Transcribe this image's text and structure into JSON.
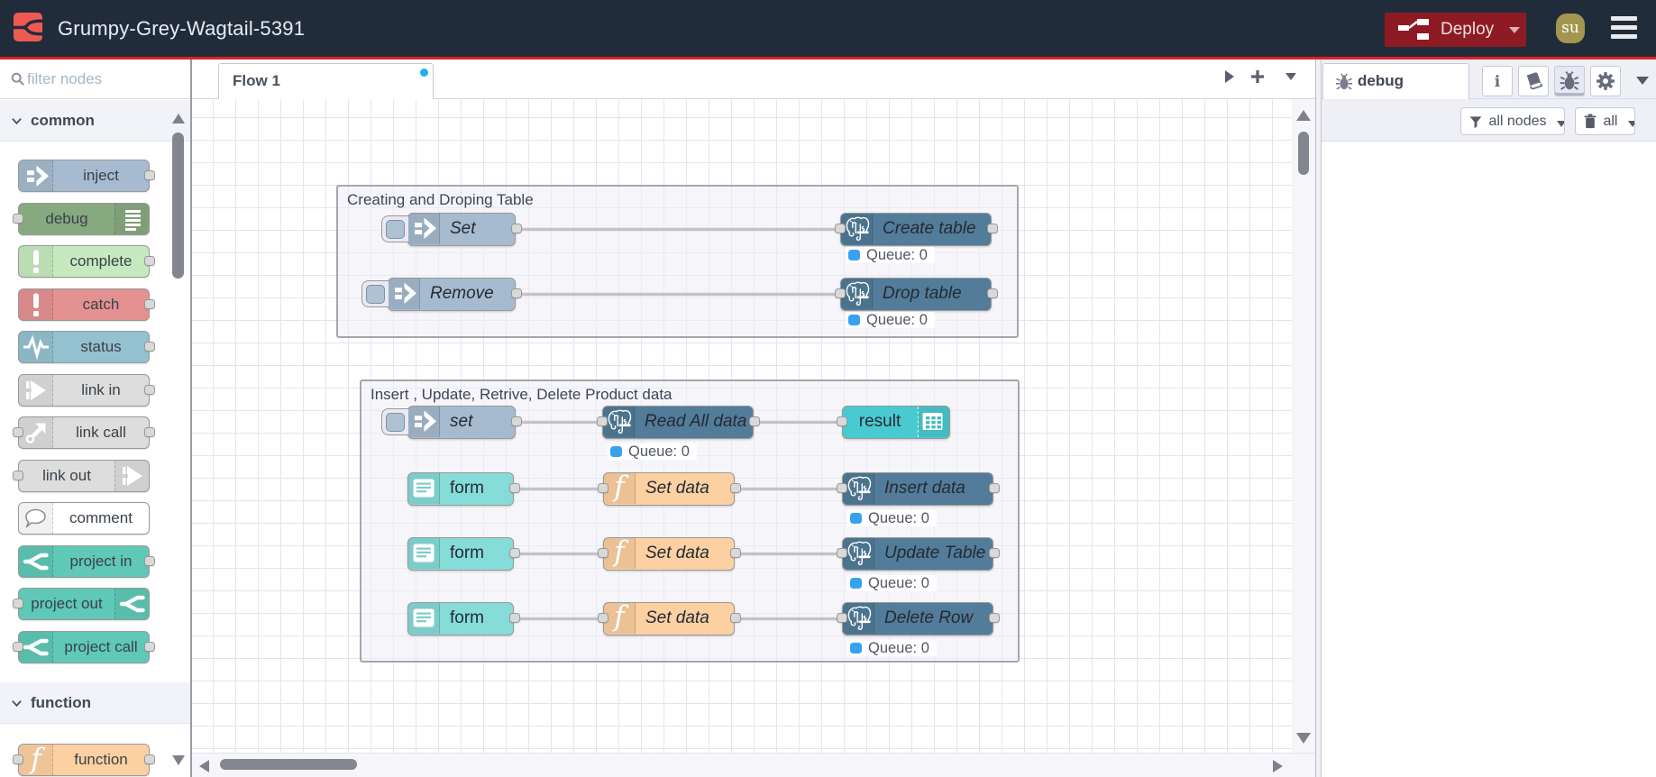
{
  "header": {
    "title": "Grumpy-Grey-Wagtail-5391",
    "deploy_label": "Deploy",
    "avatar_text": "su"
  },
  "palette": {
    "search_placeholder": "filter nodes",
    "sections": [
      {
        "label": "common",
        "items": [
          {
            "id": "inject",
            "label": "inject",
            "color": "#a6bbcf",
            "icon": "inject",
            "iconSide": "left",
            "ports": "right"
          },
          {
            "id": "debug",
            "label": "debug",
            "color": "#87a980",
            "icon": "debuglist",
            "iconSide": "right",
            "ports": "left"
          },
          {
            "id": "complete",
            "label": "complete",
            "color": "#c7e9bf",
            "icon": "exclaim",
            "iconSide": "left",
            "ports": "right"
          },
          {
            "id": "catch",
            "label": "catch",
            "color": "#e49191",
            "icon": "exclaim",
            "iconSide": "left",
            "ports": "right"
          },
          {
            "id": "status",
            "label": "status",
            "color": "#94c1d0",
            "icon": "status",
            "iconSide": "left",
            "ports": "right"
          },
          {
            "id": "link-in",
            "label": "link in",
            "color": "#dddddd",
            "icon": "linkarrow",
            "iconSide": "left",
            "ports": "right"
          },
          {
            "id": "link-call",
            "label": "link call",
            "color": "#dddddd",
            "icon": "linkcall",
            "iconSide": "left",
            "ports": "both"
          },
          {
            "id": "link-out",
            "label": "link out",
            "color": "#dddddd",
            "icon": "linkarrow",
            "iconSide": "right",
            "ports": "left"
          },
          {
            "id": "comment",
            "label": "comment",
            "color": "#ffffff",
            "icon": "comment",
            "iconSide": "left",
            "ports": "none"
          },
          {
            "id": "project-in",
            "label": "project in",
            "color": "#5fc8b6",
            "icon": "fork",
            "iconSide": "left",
            "ports": "right"
          },
          {
            "id": "project-out",
            "label": "project out",
            "color": "#5fc8b6",
            "icon": "fork",
            "iconSide": "right",
            "ports": "left"
          },
          {
            "id": "project-call",
            "label": "project call",
            "color": "#5fc8b6",
            "icon": "fork",
            "iconSide": "left",
            "ports": "both"
          }
        ]
      },
      {
        "label": "function",
        "items": [
          {
            "id": "function",
            "label": "function",
            "color": "#fdd0a2",
            "icon": "functionF",
            "iconSide": "left",
            "ports": "both"
          }
        ]
      }
    ]
  },
  "workspace": {
    "tab_label": "Flow 1"
  },
  "canvas": {
    "groups": [
      {
        "label": "Creating and Droping Table"
      },
      {
        "label": "Insert , Update, Retrive, Delete Product data"
      }
    ],
    "nodes": [
      {
        "id": "set1",
        "label": "Set",
        "type": "inject",
        "status": ""
      },
      {
        "id": "create",
        "label": "Create table",
        "type": "postgres",
        "status": "Queue: 0"
      },
      {
        "id": "remove",
        "label": "Remove",
        "type": "inject",
        "status": ""
      },
      {
        "id": "drop",
        "label": "Drop table",
        "type": "postgres",
        "status": "Queue: 0"
      },
      {
        "id": "set2",
        "label": "set",
        "type": "inject",
        "status": ""
      },
      {
        "id": "readall",
        "label": "Read All data",
        "type": "postgres",
        "status": "Queue: 0"
      },
      {
        "id": "result",
        "label": "result",
        "type": "uitable",
        "status": ""
      },
      {
        "id": "form1",
        "label": "form",
        "type": "form",
        "status": ""
      },
      {
        "id": "setdata1",
        "label": "Set data",
        "type": "function",
        "status": ""
      },
      {
        "id": "insert",
        "label": "Insert data",
        "type": "postgres",
        "status": "Queue: 0"
      },
      {
        "id": "form2",
        "label": "form",
        "type": "form",
        "status": ""
      },
      {
        "id": "setdata2",
        "label": "Set data",
        "type": "function",
        "status": ""
      },
      {
        "id": "update",
        "label": "Update Table",
        "type": "postgres",
        "status": "Queue: 0"
      },
      {
        "id": "form3",
        "label": "form",
        "type": "form",
        "status": ""
      },
      {
        "id": "setdata3",
        "label": "Set data",
        "type": "function",
        "status": ""
      },
      {
        "id": "delete",
        "label": "Delete Row",
        "type": "postgres",
        "status": "Queue: 0"
      }
    ]
  },
  "sidebar": {
    "tab_label": "debug",
    "filter_label": "all nodes",
    "clear_label": "all"
  },
  "colors": {
    "header_bg": "#212c3a",
    "header_line": "#dd2126",
    "logo_bg": "#ee5a52",
    "deploy_bg": "#8e1b24",
    "avatar_bg": "#a3974f",
    "node_inject": "#a6bbcf",
    "node_postgres": "#527c99",
    "node_function": "#fdd0a2",
    "node_form": "#86dcd8",
    "node_uitable": "#49cad0",
    "status_dot": "#38a1f0",
    "wire": "#8f8f93"
  }
}
